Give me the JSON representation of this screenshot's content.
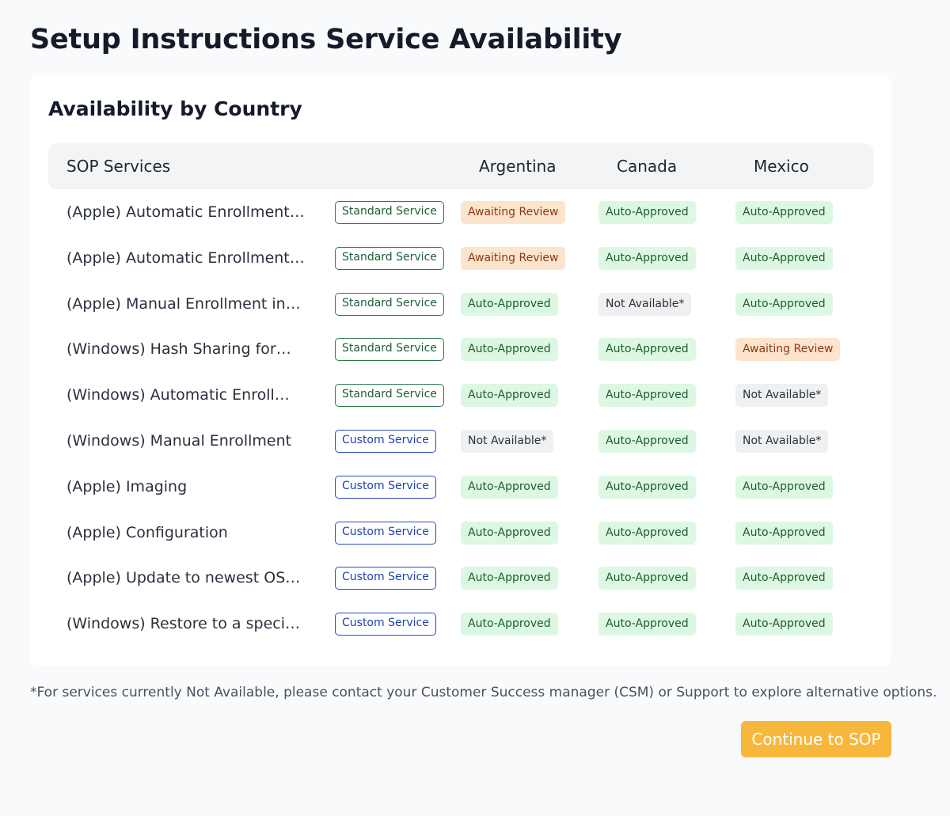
{
  "page": {
    "title": "Setup Instructions Service Availability"
  },
  "card": {
    "title": "Availability by Country"
  },
  "table": {
    "headers": {
      "service": "SOP Services",
      "countries": [
        "Argentina",
        "Canada",
        "Mexico"
      ]
    },
    "rows": [
      {
        "name": "(Apple) Automatic Enrollment…",
        "type": "Standard Service",
        "statuses": [
          "Awaiting Review",
          "Auto-Approved",
          "Auto-Approved"
        ]
      },
      {
        "name": "(Apple) Automatic Enrollment…",
        "type": "Standard Service",
        "statuses": [
          "Awaiting Review",
          "Auto-Approved",
          "Auto-Approved"
        ]
      },
      {
        "name": "(Apple) Manual Enrollment in…",
        "type": "Standard Service",
        "statuses": [
          "Auto-Approved",
          "Not Available*",
          "Auto-Approved"
        ]
      },
      {
        "name": "(Windows) Hash Sharing for…",
        "type": "Standard Service",
        "statuses": [
          "Auto-Approved",
          "Auto-Approved",
          "Awaiting Review"
        ]
      },
      {
        "name": "(Windows) Automatic Enroll…",
        "type": "Standard Service",
        "statuses": [
          "Auto-Approved",
          "Auto-Approved",
          "Not Available*"
        ]
      },
      {
        "name": "(Windows) Manual Enrollment",
        "type": "Custom Service",
        "statuses": [
          "Not Available*",
          "Auto-Approved",
          "Not Available*"
        ]
      },
      {
        "name": "(Apple) Imaging",
        "type": "Custom Service",
        "statuses": [
          "Auto-Approved",
          "Auto-Approved",
          "Auto-Approved"
        ]
      },
      {
        "name": "(Apple) Configuration",
        "type": "Custom Service",
        "statuses": [
          "Auto-Approved",
          "Auto-Approved",
          "Auto-Approved"
        ]
      },
      {
        "name": "(Apple) Update to newest OS…",
        "type": "Custom Service",
        "statuses": [
          "Auto-Approved",
          "Auto-Approved",
          "Auto-Approved"
        ]
      },
      {
        "name": "(Windows) Restore to a speci…",
        "type": "Custom Service",
        "statuses": [
          "Auto-Approved",
          "Auto-Approved",
          "Auto-Approved"
        ]
      }
    ]
  },
  "footnote": "*For services currently Not Available, please contact your Customer Success manager (CSM) or Support to explore alternative options.",
  "actions": {
    "continue_label": "Continue to SOP"
  },
  "colors": {
    "accent_button": "#f6b73c",
    "auto_approved_bg": "#dcf8e2",
    "awaiting_review_bg": "#fde4cc",
    "not_available_bg": "#eef0f2",
    "standard_tag": "#2d7a48",
    "custom_tag": "#2b49c4"
  }
}
